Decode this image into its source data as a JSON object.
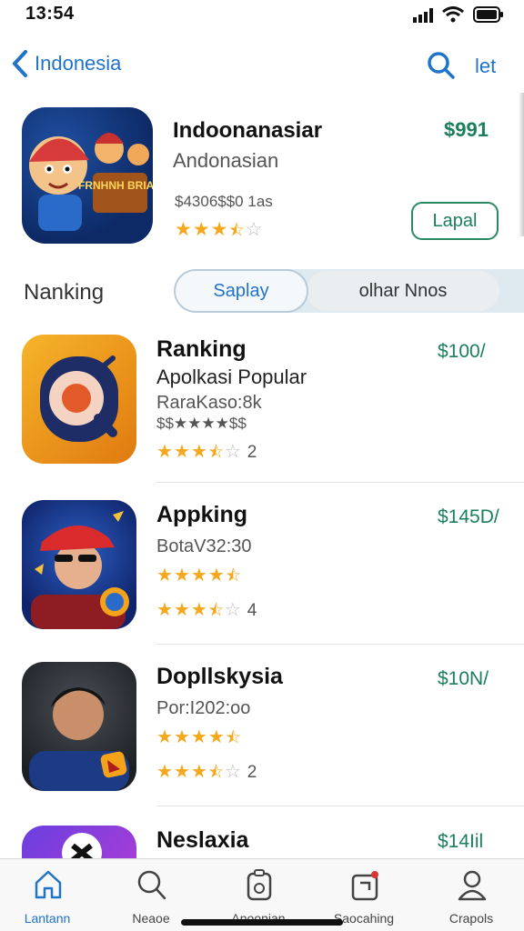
{
  "status": {
    "time": "13:54"
  },
  "nav": {
    "back_label": "Indonesia",
    "right_label": "let",
    "back_icon": "chevron-left-icon",
    "search_icon": "search-icon"
  },
  "featured": {
    "title": "Indoonanasiar",
    "subtitle": "Andonasian",
    "meta": "$4306$$0 1as",
    "price": "$991",
    "rating": 3.5,
    "button_label": "Lapal",
    "icon_text": "FRNHNH BRIAN"
  },
  "filter": {
    "label": "Nanking",
    "segment_a": "Saplay",
    "segment_b": "olhar Nnos"
  },
  "apps": [
    {
      "title": "Ranking",
      "price": "$100/",
      "subtitle": "Apolkasi Popular",
      "line1": "RaraKaso:8k",
      "line2": "$$★★★★$$",
      "rating": 3.5,
      "rating_count": "2"
    },
    {
      "title": "Appking",
      "price": "$145D/",
      "line1": "BotaV32:30",
      "rating_a": 4.5,
      "rating": 3.5,
      "rating_count": "4"
    },
    {
      "title": "Dopllskysia",
      "price": "$10N/",
      "line1": "Por:I202:oo",
      "rating_a": 4.5,
      "rating": 3.5,
      "rating_count": "2"
    },
    {
      "title": "Neslaxia",
      "price": "$14Iil"
    }
  ],
  "tabs": [
    {
      "label": "Lantann",
      "icon": "home-icon",
      "active": true
    },
    {
      "label": "Neaoe",
      "icon": "search-icon",
      "active": false
    },
    {
      "label": "Anoonian",
      "icon": "apps-icon",
      "active": false
    },
    {
      "label": "Saocahing",
      "icon": "updates-icon",
      "active": false
    },
    {
      "label": "Crapols",
      "icon": "profile-icon",
      "active": false
    }
  ],
  "colors": {
    "accent": "#1f73c9",
    "price": "#1a7f5a",
    "star": "#f3a81d"
  }
}
